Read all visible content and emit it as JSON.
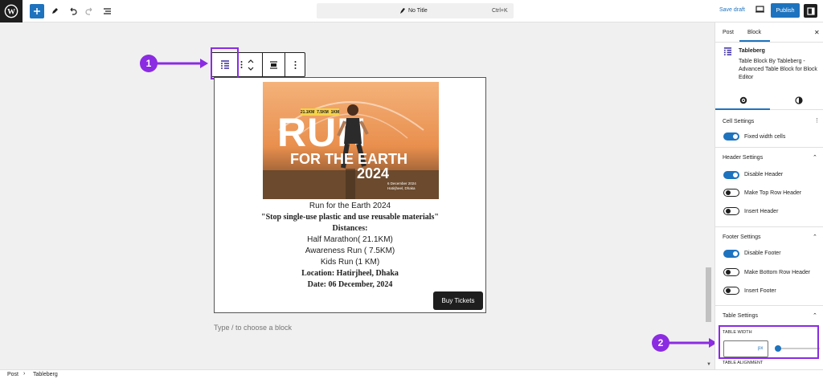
{
  "topbar": {
    "title": "No Title",
    "shortcut": "Ctrl+K",
    "save_draft": "Save draft",
    "publish": "Publish",
    "icons": [
      "wordpress-logo",
      "plus-icon",
      "pen-icon",
      "undo-icon",
      "redo-icon",
      "list-view-icon",
      "document-icon",
      "desktop-view-icon",
      "settings-icon"
    ]
  },
  "annotations": {
    "first": "1",
    "second": "2"
  },
  "poster": {
    "distances": "21.1KM  7.5KM  1KM",
    "big1": "RUN",
    "big2": "FOR THE EARTH",
    "year": "2024",
    "date_line1": "6 December 2024",
    "date_line2": "Hatirjheel, Dhaka"
  },
  "table": {
    "rows": [
      "Run for the Earth 2024",
      "\"Stop single-use plastic and use reusable materials\"",
      "Distances:",
      "Half Marathon( 21.1KM)",
      "Awareness Run ( 7.5KM)",
      "Kids Run (1 KM)",
      "Location: Hatirjheel, Dhaka",
      "Date: 06 December, 2024"
    ],
    "button": "Buy Tickets"
  },
  "canvas": {
    "placeholder": "Type / to choose a block"
  },
  "sidebar": {
    "tab_post": "Post",
    "tab_block": "Block",
    "block_name": "Tableberg",
    "block_desc": "Table Block By Tableberg - Advanced Table Block for Block Editor",
    "cell_settings": "Cell Settings",
    "fixed_width": "Fixed width cells",
    "header_settings": "Header Settings",
    "disable_header": "Disable Header",
    "top_row_header": "Make Top Row Header",
    "insert_header": "Insert Header",
    "footer_settings": "Footer Settings",
    "disable_footer": "Disable Footer",
    "bottom_row_header": "Make Bottom Row Header",
    "insert_footer": "Insert Footer",
    "table_settings": "Table Settings",
    "table_width": "TABLE WIDTH",
    "unit": "px",
    "table_alignment": "TABLE ALIGNMENT"
  },
  "breadcrumb": {
    "post": "Post",
    "sep": "›",
    "block": "Tableberg"
  },
  "colors": {
    "accent": "#1e73be",
    "annotation": "#8b2be2"
  }
}
